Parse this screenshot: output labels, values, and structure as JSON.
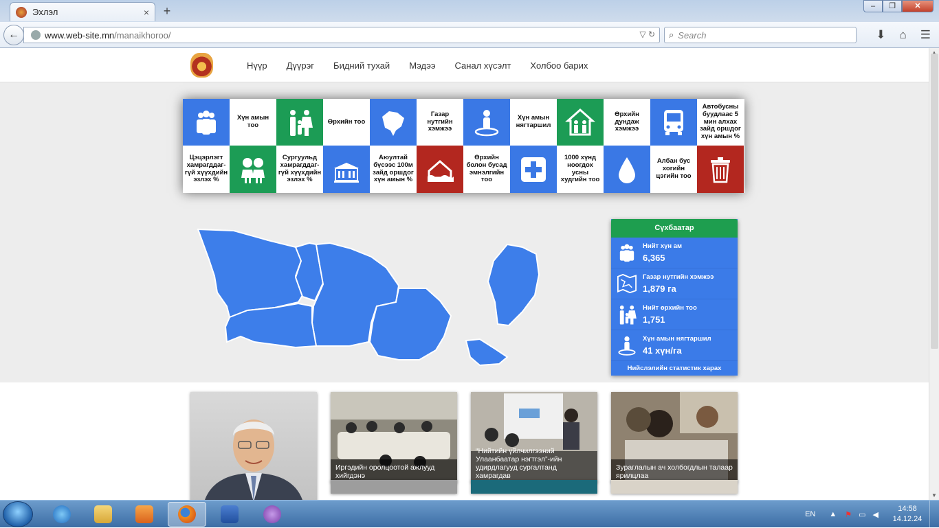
{
  "browser": {
    "tab_title": "Эхлэл",
    "tab_close": "×",
    "new_tab": "+",
    "url_host": "www.web-site.mn",
    "url_path": "/manaikhoroo/",
    "search_placeholder": "Search"
  },
  "site": {
    "menu": [
      "Нүүр",
      "Дүүрэг",
      "Бидний тухай",
      "Мэдээ",
      "Санал хүсэлт",
      "Холбоо барих"
    ]
  },
  "tiles": [
    {
      "kind": "icon",
      "color": "blue",
      "icon": "people-group-icon"
    },
    {
      "kind": "text",
      "text": "Хүн амын тоо"
    },
    {
      "kind": "icon",
      "color": "green",
      "icon": "family-icon"
    },
    {
      "kind": "text",
      "text": "Өрхийн тоо"
    },
    {
      "kind": "icon",
      "color": "blue",
      "icon": "map-brazil-icon"
    },
    {
      "kind": "text",
      "text": "Газар нутгийн хэмжээ"
    },
    {
      "kind": "icon",
      "color": "blue",
      "icon": "person-location-icon"
    },
    {
      "kind": "text",
      "text": "Хүн амын нягтаршил"
    },
    {
      "kind": "icon",
      "color": "green",
      "icon": "house-family-icon"
    },
    {
      "kind": "text",
      "text": "Өрхийн дундаж хэмжээ"
    },
    {
      "kind": "icon",
      "color": "blue",
      "icon": "bus-icon"
    },
    {
      "kind": "text",
      "text": "Автобусны буудлаас 5 мин алхах зайд оршдог хүн амын %"
    },
    {
      "kind": "text",
      "text": "Цэцэрлэгт хамрагддаг-гүй хүүхдийн эзлэх %"
    },
    {
      "kind": "icon",
      "color": "green",
      "icon": "children-icon"
    },
    {
      "kind": "text",
      "text": "Сургуульд хамрагддаг-гүй хүүхдийн эзлэх %"
    },
    {
      "kind": "icon",
      "color": "blue",
      "icon": "school-building-icon"
    },
    {
      "kind": "text",
      "text": "Аюултай бүсээс 100м зайд оршдог хүн амын %"
    },
    {
      "kind": "icon",
      "color": "red",
      "icon": "flood-house-icon"
    },
    {
      "kind": "text",
      "text": "Өрхийн болон бусад эмнэлгийн тоо"
    },
    {
      "kind": "icon",
      "color": "blue",
      "icon": "medical-cross-icon"
    },
    {
      "kind": "text",
      "text": "1000 хүнд ноогдох усны худгийн тоо"
    },
    {
      "kind": "icon",
      "color": "blue",
      "icon": "water-drop-icon"
    },
    {
      "kind": "text",
      "text": "Албан бус хогийн цэгийн тоо"
    },
    {
      "kind": "icon",
      "color": "red",
      "icon": "trash-can-icon"
    }
  ],
  "panel": {
    "title": "Сүхбаатар",
    "stats": [
      {
        "label": "Нийт хүн ам",
        "value": "6,365",
        "icon": "people-group-icon"
      },
      {
        "label": "Газар нутгийн хэмжээ",
        "value": "1,879 га",
        "icon": "map-icon"
      },
      {
        "label": "Нийт өрхийн тоо",
        "value": "1,751",
        "icon": "family-icon"
      },
      {
        "label": "Хүн амын нягтаршил",
        "value": "41 хүн/га",
        "icon": "person-location-icon"
      }
    ],
    "footer_link": "Нийслэлийн статистик харах"
  },
  "news": [
    {
      "caption": "Иргэдийн оролцоотой ажлууд хийгдэнэ"
    },
    {
      "caption": "“Нийтийн үйлчилгээний Улаанбаатар нэгтгэл”-ийн удирдлагууд сургалтанд хамрагдав"
    },
    {
      "caption": "Зураглалын ач холбогдлын талаар ярилцлаа"
    }
  ],
  "taskbar": {
    "lang": "EN",
    "time": "14:58",
    "date": "14.12.24"
  },
  "colors": {
    "tile_blue": "#3a78e5",
    "tile_green": "#1c9c55",
    "tile_red": "#b3271f",
    "map_blue": "#3d7eea",
    "panel_header": "#1e9e4f"
  }
}
